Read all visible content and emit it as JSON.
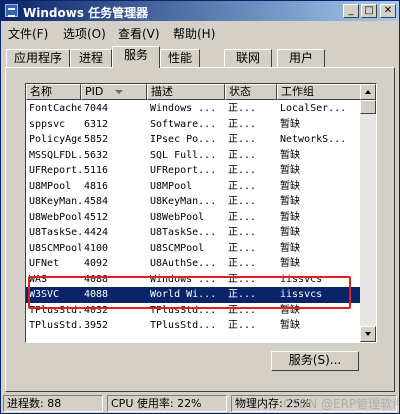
{
  "window": {
    "title": "Windows 任务管理器",
    "min_label": "_",
    "max_label": "□",
    "close_label": "✕"
  },
  "menu": [
    {
      "label": "文件(F)"
    },
    {
      "label": "选项(O)"
    },
    {
      "label": "查看(V)"
    },
    {
      "label": "帮助(H)"
    }
  ],
  "tabs": [
    {
      "label": "应用程序"
    },
    {
      "label": "进程"
    },
    {
      "label": "服务"
    },
    {
      "label": "性能"
    },
    {
      "label": "联网"
    },
    {
      "label": "用户"
    }
  ],
  "active_tab": "服务",
  "table": {
    "columns": [
      "名称",
      "PID",
      "描述",
      "状态",
      "工作组"
    ],
    "rows": [
      [
        "FontCache",
        "7044",
        "Windows ...",
        "正...",
        "LocalSer..."
      ],
      [
        "sppsvc",
        "6312",
        "Software...",
        "正...",
        "暂缺"
      ],
      [
        "PolicyAgent",
        "5852",
        "IPsec Po...",
        "正...",
        "NetworkS..."
      ],
      [
        "MSSQLFDL...",
        "5632",
        "SQL Full...",
        "正...",
        "暂缺"
      ],
      [
        "UFReport...",
        "5116",
        "UFReport...",
        "正...",
        "暂缺"
      ],
      [
        "U8MPool",
        "4816",
        "U8MPool",
        "正...",
        "暂缺"
      ],
      [
        "U8KeyMan...",
        "4584",
        "U8KeyMan...",
        "正...",
        "暂缺"
      ],
      [
        "U8WebPool",
        "4512",
        "U8WebPool",
        "正...",
        "暂缺"
      ],
      [
        "U8TaskSe...",
        "4424",
        "U8TaskSe...",
        "正...",
        "暂缺"
      ],
      [
        "U8SCMPool",
        "4100",
        "U8SCMPool",
        "正...",
        "暂缺"
      ],
      [
        "UFNet",
        "4092",
        "U8AuthSe...",
        "正...",
        "暂缺"
      ],
      [
        "WAS",
        "4088",
        "Windows ...",
        "正...",
        "iissvcs"
      ],
      [
        "W3SVC",
        "4088",
        "World Wi...",
        "正...",
        "iissvcs"
      ],
      [
        "TPlusStd...",
        "4032",
        "TPlusStd...",
        "正...",
        "暂缺"
      ],
      [
        "TPlusStd...",
        "3952",
        "TPlusStd...",
        "正...",
        "暂缺"
      ]
    ],
    "selected_row": 12
  },
  "services_button": "服务(S)...",
  "status": {
    "processes": "进程数: 88",
    "cpu": "CPU 使用率: 22%",
    "memory": "物理内存: 25%"
  },
  "watermark": "CSDN @ERP管理软件",
  "colors": {
    "title_start": "#0a246a",
    "title_end": "#a6caf0",
    "selection": "#0a246a",
    "highlight_box": "#e02020"
  }
}
